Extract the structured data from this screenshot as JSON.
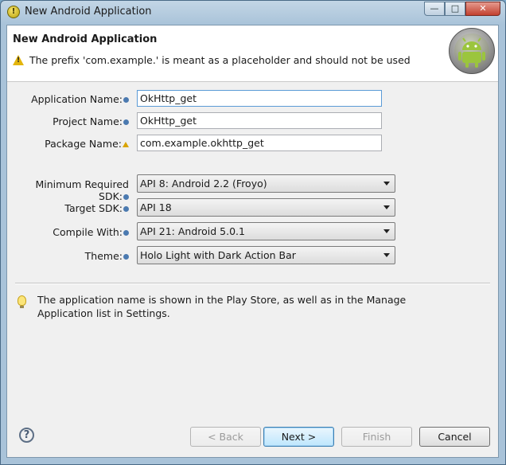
{
  "window": {
    "title": "New Android Application",
    "minimize_glyph": "—",
    "maximize_glyph": "□",
    "close_glyph": "✕"
  },
  "header": {
    "title": "New Android Application",
    "warning": "The prefix 'com.example.' is meant as a placeholder and should not be used"
  },
  "form": {
    "application_name_label": "Application Name:",
    "application_name_value": "OkHttp_get",
    "project_name_label": "Project Name:",
    "project_name_value": "OkHttp_get",
    "package_name_label": "Package Name:",
    "package_name_value": "com.example.okhttp_get",
    "min_sdk_label": "Minimum Required SDK:",
    "min_sdk_value": "API 8: Android 2.2 (Froyo)",
    "target_sdk_label": "Target SDK:",
    "target_sdk_value": "API 18",
    "compile_with_label": "Compile With:",
    "compile_with_value": "API 21: Android 5.0.1",
    "theme_label": "Theme:",
    "theme_value": "Holo Light with Dark Action Bar"
  },
  "hint": "The application name is shown in the Play Store, as well as in the Manage Application list in Settings.",
  "buttons": {
    "help": "?",
    "back": "< Back",
    "next": "Next >",
    "finish": "Finish",
    "cancel": "Cancel"
  },
  "colors": {
    "accent_focus": "#5b9bd6",
    "warning": "#e3b50c"
  }
}
